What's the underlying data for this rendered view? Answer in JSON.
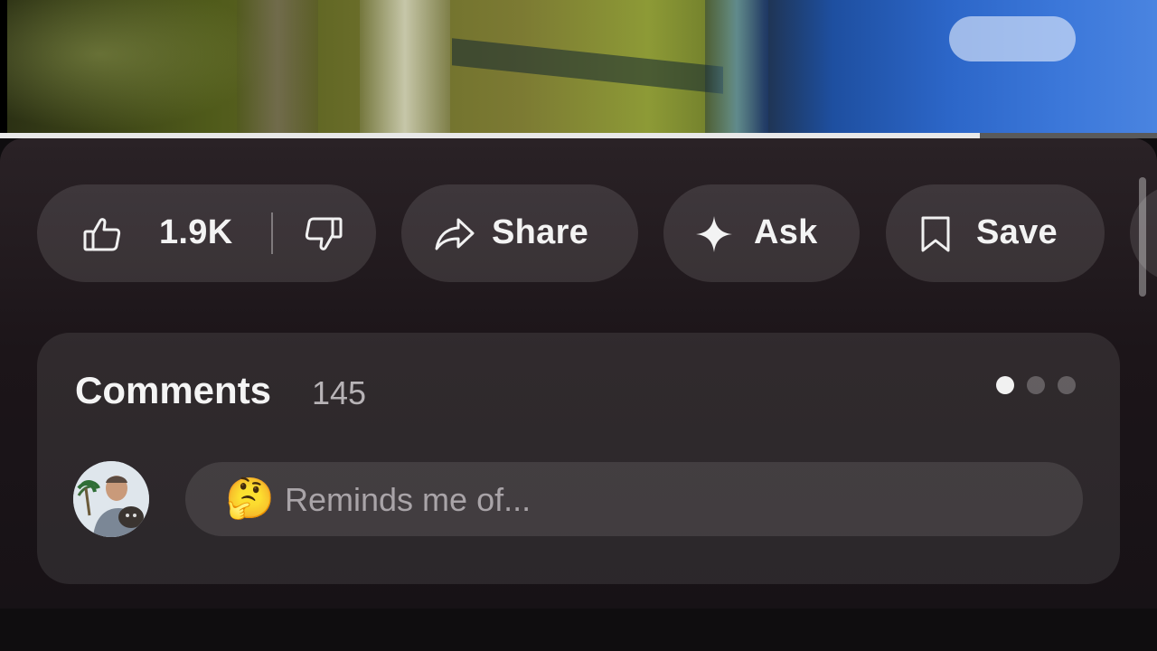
{
  "video": {
    "progress_percent": 84.7
  },
  "actions": {
    "like_count": "1.9K",
    "share_label": "Share",
    "ask_label": "Ask",
    "save_label": "Save",
    "icons": {
      "like": "thumbs-up-icon",
      "dislike": "thumbs-down-icon",
      "share": "share-arrow-icon",
      "ask": "sparkle-icon",
      "save": "bookmark-icon"
    }
  },
  "comments": {
    "title": "Comments",
    "count": "145",
    "pager": {
      "pages": 3,
      "active_index": 0
    },
    "input": {
      "emoji": "🤔",
      "placeholder": "Reminds me of..."
    }
  },
  "colors": {
    "sheet_bg": "#1c1519",
    "pill_bg": "#3a3337",
    "text": "#f1f1f1",
    "muted": "#b7b3b6",
    "progress": "#e8e8e8"
  }
}
